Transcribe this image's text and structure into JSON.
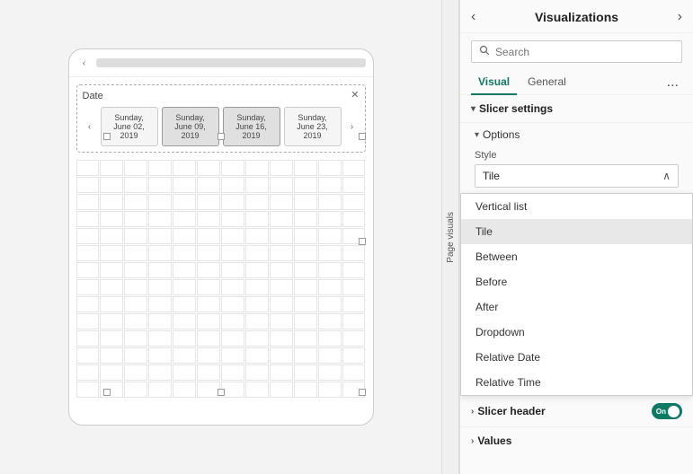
{
  "panel": {
    "title": "Visualizations",
    "leftArrowLabel": "‹",
    "rightArrowLabel": "›",
    "pageVisualsLabel": "Page visuals"
  },
  "search": {
    "placeholder": "Search",
    "value": "Search",
    "icon": "🔍"
  },
  "tabs": [
    {
      "id": "visual",
      "label": "Visual",
      "active": true
    },
    {
      "id": "general",
      "label": "General",
      "active": false
    }
  ],
  "tabMore": "...",
  "sections": {
    "slicerSettings": {
      "label": "Slicer settings",
      "chevron": "▾"
    },
    "options": {
      "label": "Options",
      "chevron": "▾"
    },
    "style": {
      "label": "Style",
      "dropdownValue": "Tile",
      "dropdownChevron": "∧"
    },
    "slicerHeader": {
      "label": "Slicer header",
      "chevron": "›",
      "toggleOn": true,
      "toggleLabel": "On"
    },
    "values": {
      "label": "Values",
      "chevron": "›"
    }
  },
  "dropdown": {
    "items": [
      {
        "id": "vertical-list",
        "label": "Vertical list",
        "selected": false
      },
      {
        "id": "tile",
        "label": "Tile",
        "selected": true
      },
      {
        "id": "between",
        "label": "Between",
        "selected": false
      },
      {
        "id": "before",
        "label": "Before",
        "selected": false
      },
      {
        "id": "after",
        "label": "After",
        "selected": false
      },
      {
        "id": "dropdown",
        "label": "Dropdown",
        "selected": false
      },
      {
        "id": "relative-date",
        "label": "Relative Date",
        "selected": false
      },
      {
        "id": "relative-time",
        "label": "Relative Time",
        "selected": false
      }
    ]
  },
  "dateSlicer": {
    "label": "Date",
    "closeLabel": "✕",
    "prevArrow": "‹",
    "nextArrow": "›",
    "tiles": [
      {
        "line1": "Sunday,",
        "line2": "June 02,",
        "line3": "2019"
      },
      {
        "line1": "Sunday,",
        "line2": "June 09,",
        "line3": "2019"
      },
      {
        "line1": "Sunday,",
        "line2": "June 16,",
        "line3": "2019"
      },
      {
        "line1": "Sunday,",
        "line2": "June 23,",
        "line3": "2019"
      }
    ]
  }
}
